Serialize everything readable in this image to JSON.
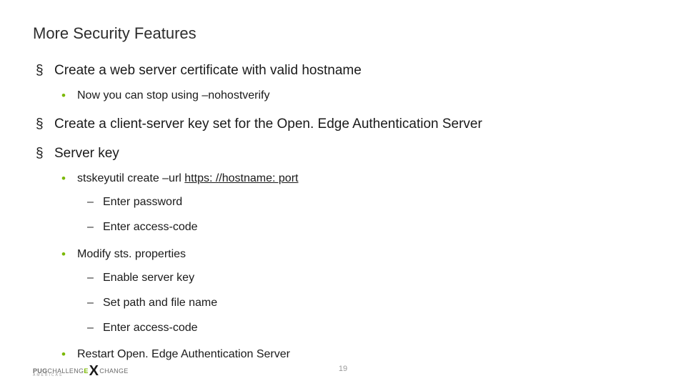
{
  "title": "More Security Features",
  "bullets": {
    "b1": "Create a web server certificate with valid hostname",
    "b1_1": "Now you can stop using –nohostverify",
    "b2": "Create a client-server key set for the Open. Edge Authentication Server",
    "b3": "Server key",
    "b3_1_pre": "stskeyutil create –url ",
    "b3_1_link": "https: //hostname: port",
    "b3_1_a": "Enter password",
    "b3_1_b": "Enter access-code",
    "b3_2": "Modify sts. properties",
    "b3_2_a": "Enable server key",
    "b3_2_b": "Set path and file name",
    "b3_2_c": "Enter access-code",
    "b3_3": "Restart Open. Edge Authentication Server"
  },
  "footer": {
    "pug": "PUG",
    "challenge": "CHALLENG",
    "e": "E",
    "change": "CHANGE",
    "sub": "AMERICAS"
  },
  "pagenum": "19"
}
